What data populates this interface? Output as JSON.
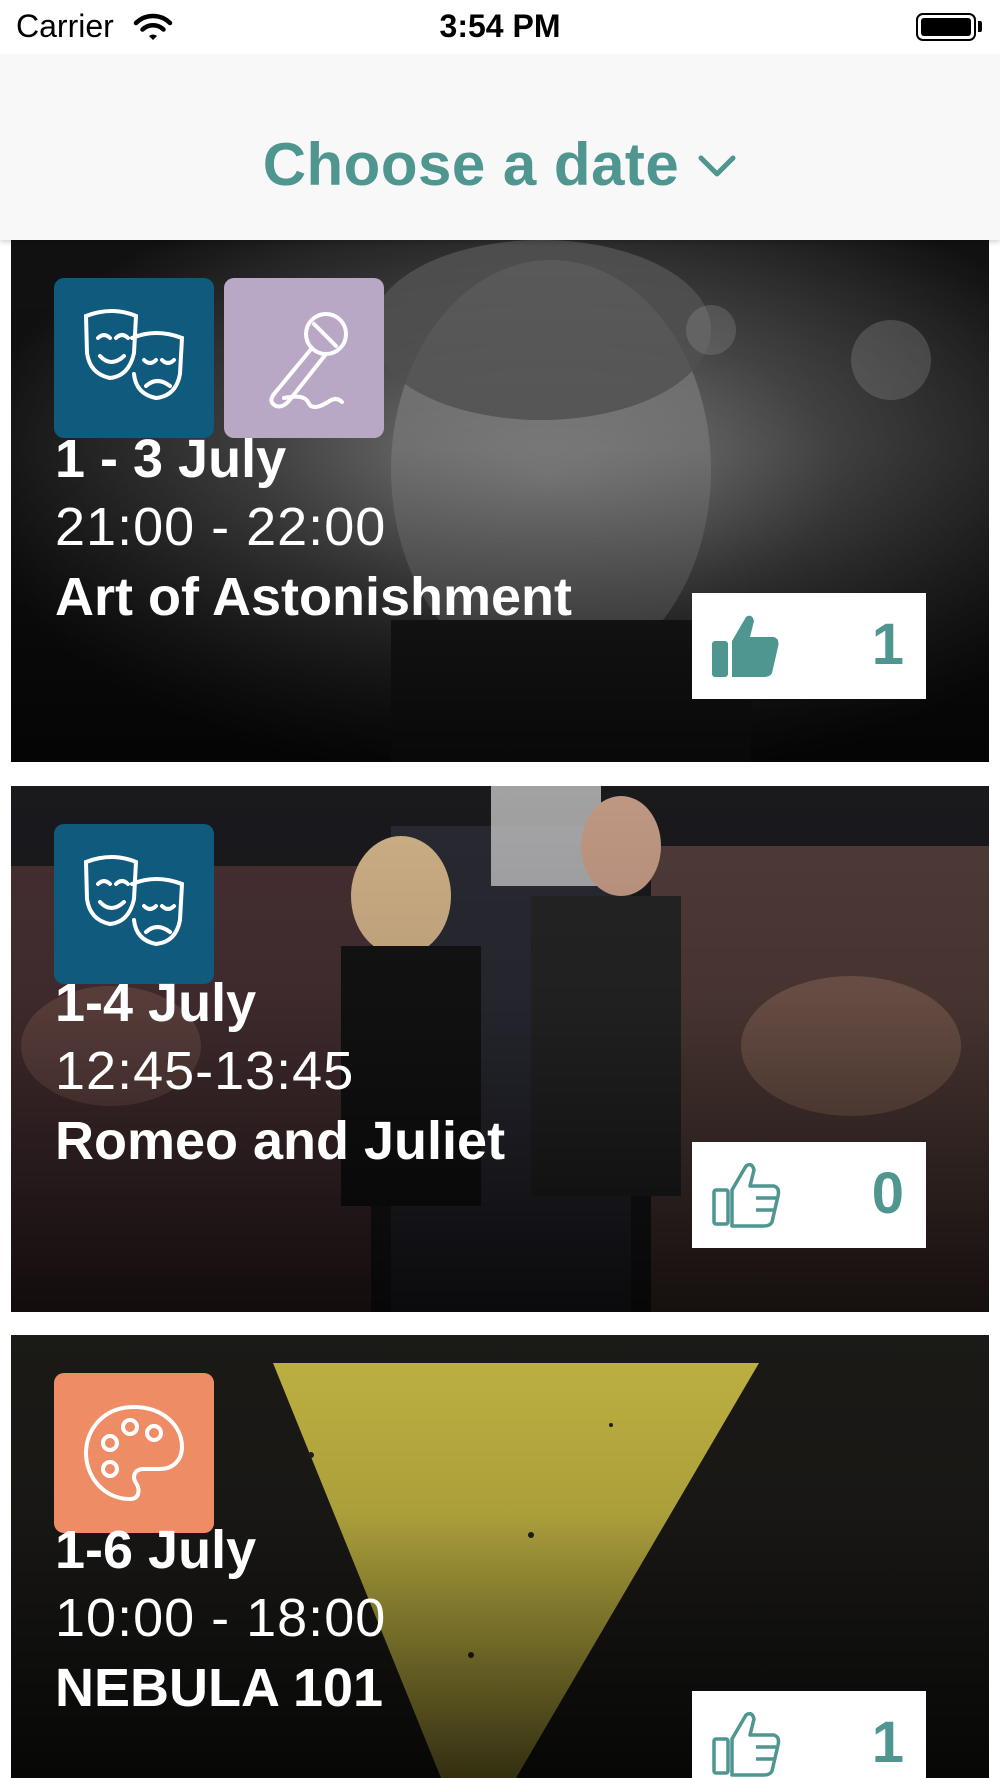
{
  "status": {
    "carrier": "Carrier",
    "time": "3:54 PM"
  },
  "header": {
    "title": "Choose a date"
  },
  "colors": {
    "accent": "#4f9590",
    "theatre": "#0f5a7d",
    "music": "#b9a7c6",
    "art": "#ee8c66"
  },
  "events": [
    {
      "dates": "1 - 3 July",
      "time": "21:00 - 22:00",
      "title": "Art of Astonishment",
      "likes": "1",
      "liked": true,
      "categories": [
        "theatre-masks-icon",
        "microphone-icon"
      ]
    },
    {
      "dates": "1-4 July",
      "time": "12:45-13:45",
      "title": "Romeo and Juliet",
      "likes": "0",
      "liked": false,
      "categories": [
        "theatre-masks-icon"
      ]
    },
    {
      "dates": "1-6 July",
      "time": "10:00 - 18:00",
      "title": "NEBULA 101",
      "likes": "1",
      "liked": false,
      "categories": [
        "palette-icon"
      ]
    }
  ]
}
